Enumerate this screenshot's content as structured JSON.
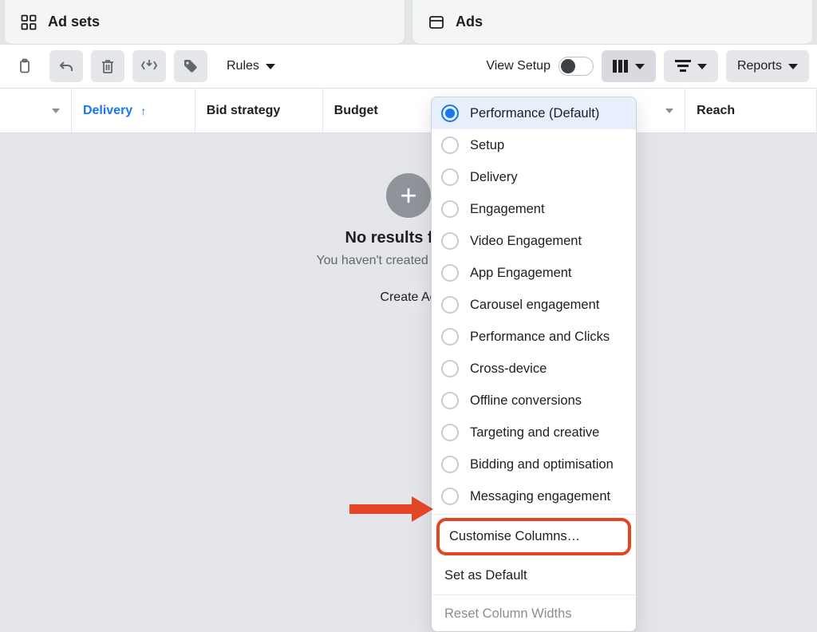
{
  "tabs": {
    "ad_sets": "Ad sets",
    "ads": "Ads"
  },
  "toolbar": {
    "rules_label": "Rules",
    "view_setup_label": "View Setup",
    "reports_label": "Reports"
  },
  "columns": {
    "delivery": "Delivery",
    "bid_strategy": "Bid strategy",
    "budget": "Budget",
    "reach": "Reach"
  },
  "empty_state": {
    "title": "No results found",
    "subtitle": "You haven't created any ads yet.",
    "cta": "Create Ad"
  },
  "column_presets": {
    "options": [
      "Performance (Default)",
      "Setup",
      "Delivery",
      "Engagement",
      "Video Engagement",
      "App Engagement",
      "Carousel engagement",
      "Performance and Clicks",
      "Cross-device",
      "Offline conversions",
      "Targeting and creative",
      "Bidding and optimisation",
      "Messaging engagement"
    ],
    "customise": "Customise Columns…",
    "set_default": "Set as Default",
    "reset_widths": "Reset Column Widths"
  }
}
